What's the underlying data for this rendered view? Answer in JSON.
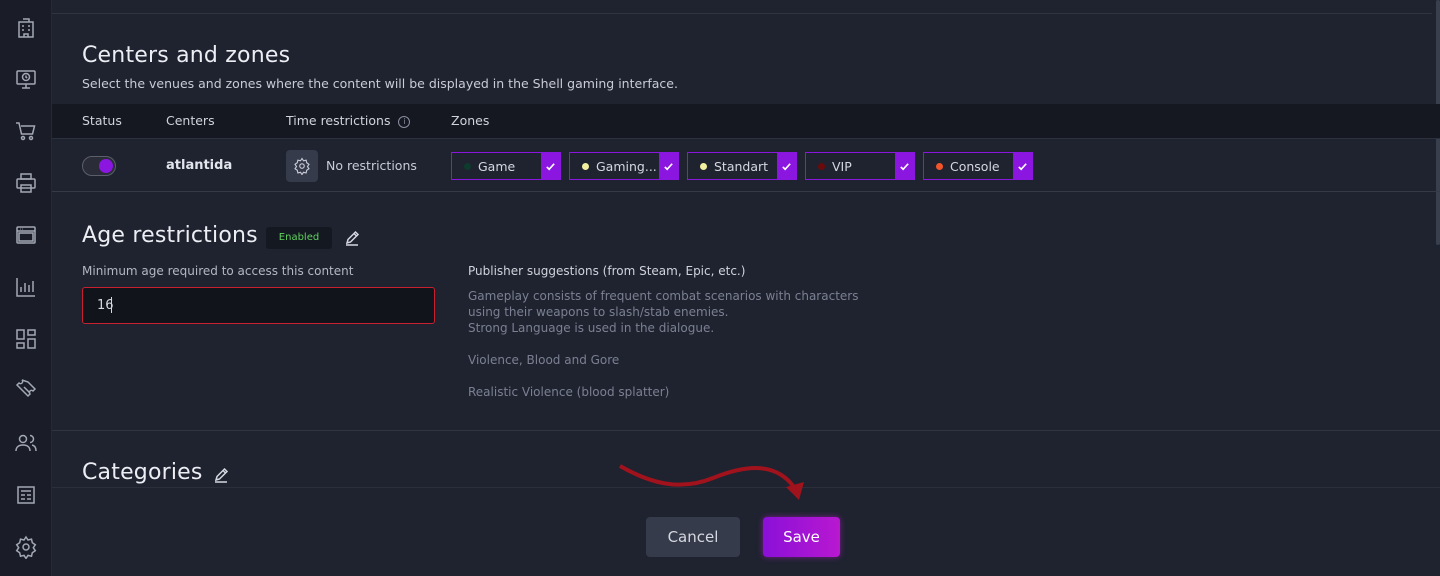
{
  "sidebar": {
    "icons": [
      "building-icon",
      "monitor-clock-icon",
      "cart-icon",
      "printer-icon",
      "browser-window-icon",
      "bar-chart-icon",
      "dashboard-grid-icon",
      "ticket-icon",
      "users-icon",
      "newspaper-icon",
      "settings-gear-icon"
    ]
  },
  "centers_zones": {
    "title": "Centers and zones",
    "description": "Select the venues and zones where the content will be displayed in the Shell gaming interface.",
    "columns": {
      "status": "Status",
      "centers": "Centers",
      "time": "Time restrictions",
      "zones": "Zones"
    },
    "row": {
      "status_on": true,
      "center": "atlantida",
      "time_restriction": "No restrictions",
      "zones": [
        {
          "label": "Game",
          "dot_color": "#0e3b2c"
        },
        {
          "label": "Gaming...",
          "dot_color": "#f2f0a0"
        },
        {
          "label": "Standart",
          "dot_color": "#f2f0a0"
        },
        {
          "label": "VIP",
          "dot_color": "#6a0a0a"
        },
        {
          "label": "Console",
          "dot_color": "#f2552a"
        }
      ]
    }
  },
  "age": {
    "title": "Age restrictions",
    "badge": "Enabled",
    "field_label": "Minimum age required to access this content",
    "value": "16",
    "publisher_title": "Publisher suggestions (from Steam, Epic, etc.)",
    "publisher_lines": [
      "Gameplay consists of frequent combat scenarios with characters",
      "using their weapons to slash/stab enemies.",
      "Strong Language is used in the dialogue.",
      "Violence, Blood and Gore",
      "Realistic Violence (blood splatter)"
    ]
  },
  "categories": {
    "title": "Categories"
  },
  "footer": {
    "cancel": "Cancel",
    "save": "Save"
  },
  "colors": {
    "accent": "#8b16e0",
    "error": "#c8202e",
    "badge_text": "#5ed15e"
  }
}
